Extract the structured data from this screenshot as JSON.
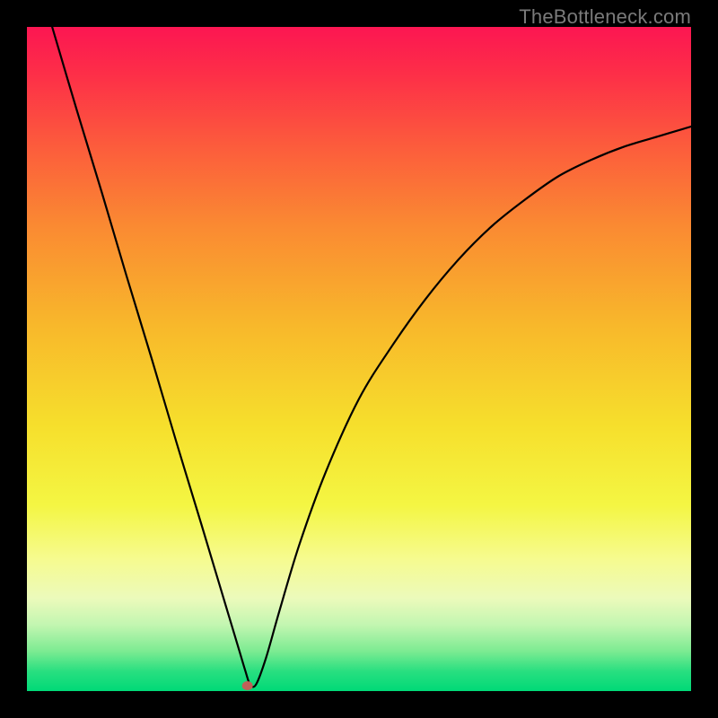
{
  "watermark": "TheBottleneck.com",
  "chart_data": {
    "type": "line",
    "title": "",
    "xlabel": "",
    "ylabel": "",
    "xlim": [
      0,
      100
    ],
    "ylim": [
      0,
      100
    ],
    "grid": false,
    "legend": false,
    "series": [
      {
        "name": "curve",
        "color": "#000000",
        "x": [
          3.8,
          7.5,
          11.3,
          15.0,
          18.8,
          22.5,
          26.3,
          29.0,
          30.5,
          32.0,
          32.9,
          33.6,
          34.5,
          36.0,
          38.0,
          41.0,
          45.0,
          50.0,
          55.0,
          60.0,
          65.0,
          70.0,
          75.0,
          80.0,
          85.0,
          90.0,
          95.0,
          100.0
        ],
        "y": [
          100.0,
          87.5,
          75.0,
          62.5,
          50.0,
          37.5,
          25.0,
          16.0,
          11.0,
          6.0,
          3.0,
          1.0,
          1.0,
          5.0,
          12.0,
          22.0,
          33.0,
          44.0,
          52.0,
          59.0,
          65.0,
          70.0,
          74.0,
          77.5,
          80.0,
          82.0,
          83.5,
          85.0
        ]
      }
    ],
    "marker": {
      "x": 33.2,
      "y": 0.8,
      "color": "#c06058",
      "r": 6
    },
    "gradient_stops": [
      {
        "offset": 0.0,
        "color": "#fc1652"
      },
      {
        "offset": 0.07,
        "color": "#fd2e48"
      },
      {
        "offset": 0.18,
        "color": "#fc5c3c"
      },
      {
        "offset": 0.3,
        "color": "#fa8a32"
      },
      {
        "offset": 0.45,
        "color": "#f8b82b"
      },
      {
        "offset": 0.6,
        "color": "#f6df2c"
      },
      {
        "offset": 0.72,
        "color": "#f4f643"
      },
      {
        "offset": 0.8,
        "color": "#f6fb8e"
      },
      {
        "offset": 0.86,
        "color": "#ecfabb"
      },
      {
        "offset": 0.9,
        "color": "#c3f6b1"
      },
      {
        "offset": 0.94,
        "color": "#7ceb92"
      },
      {
        "offset": 0.97,
        "color": "#29df80"
      },
      {
        "offset": 1.0,
        "color": "#00d977"
      }
    ]
  }
}
